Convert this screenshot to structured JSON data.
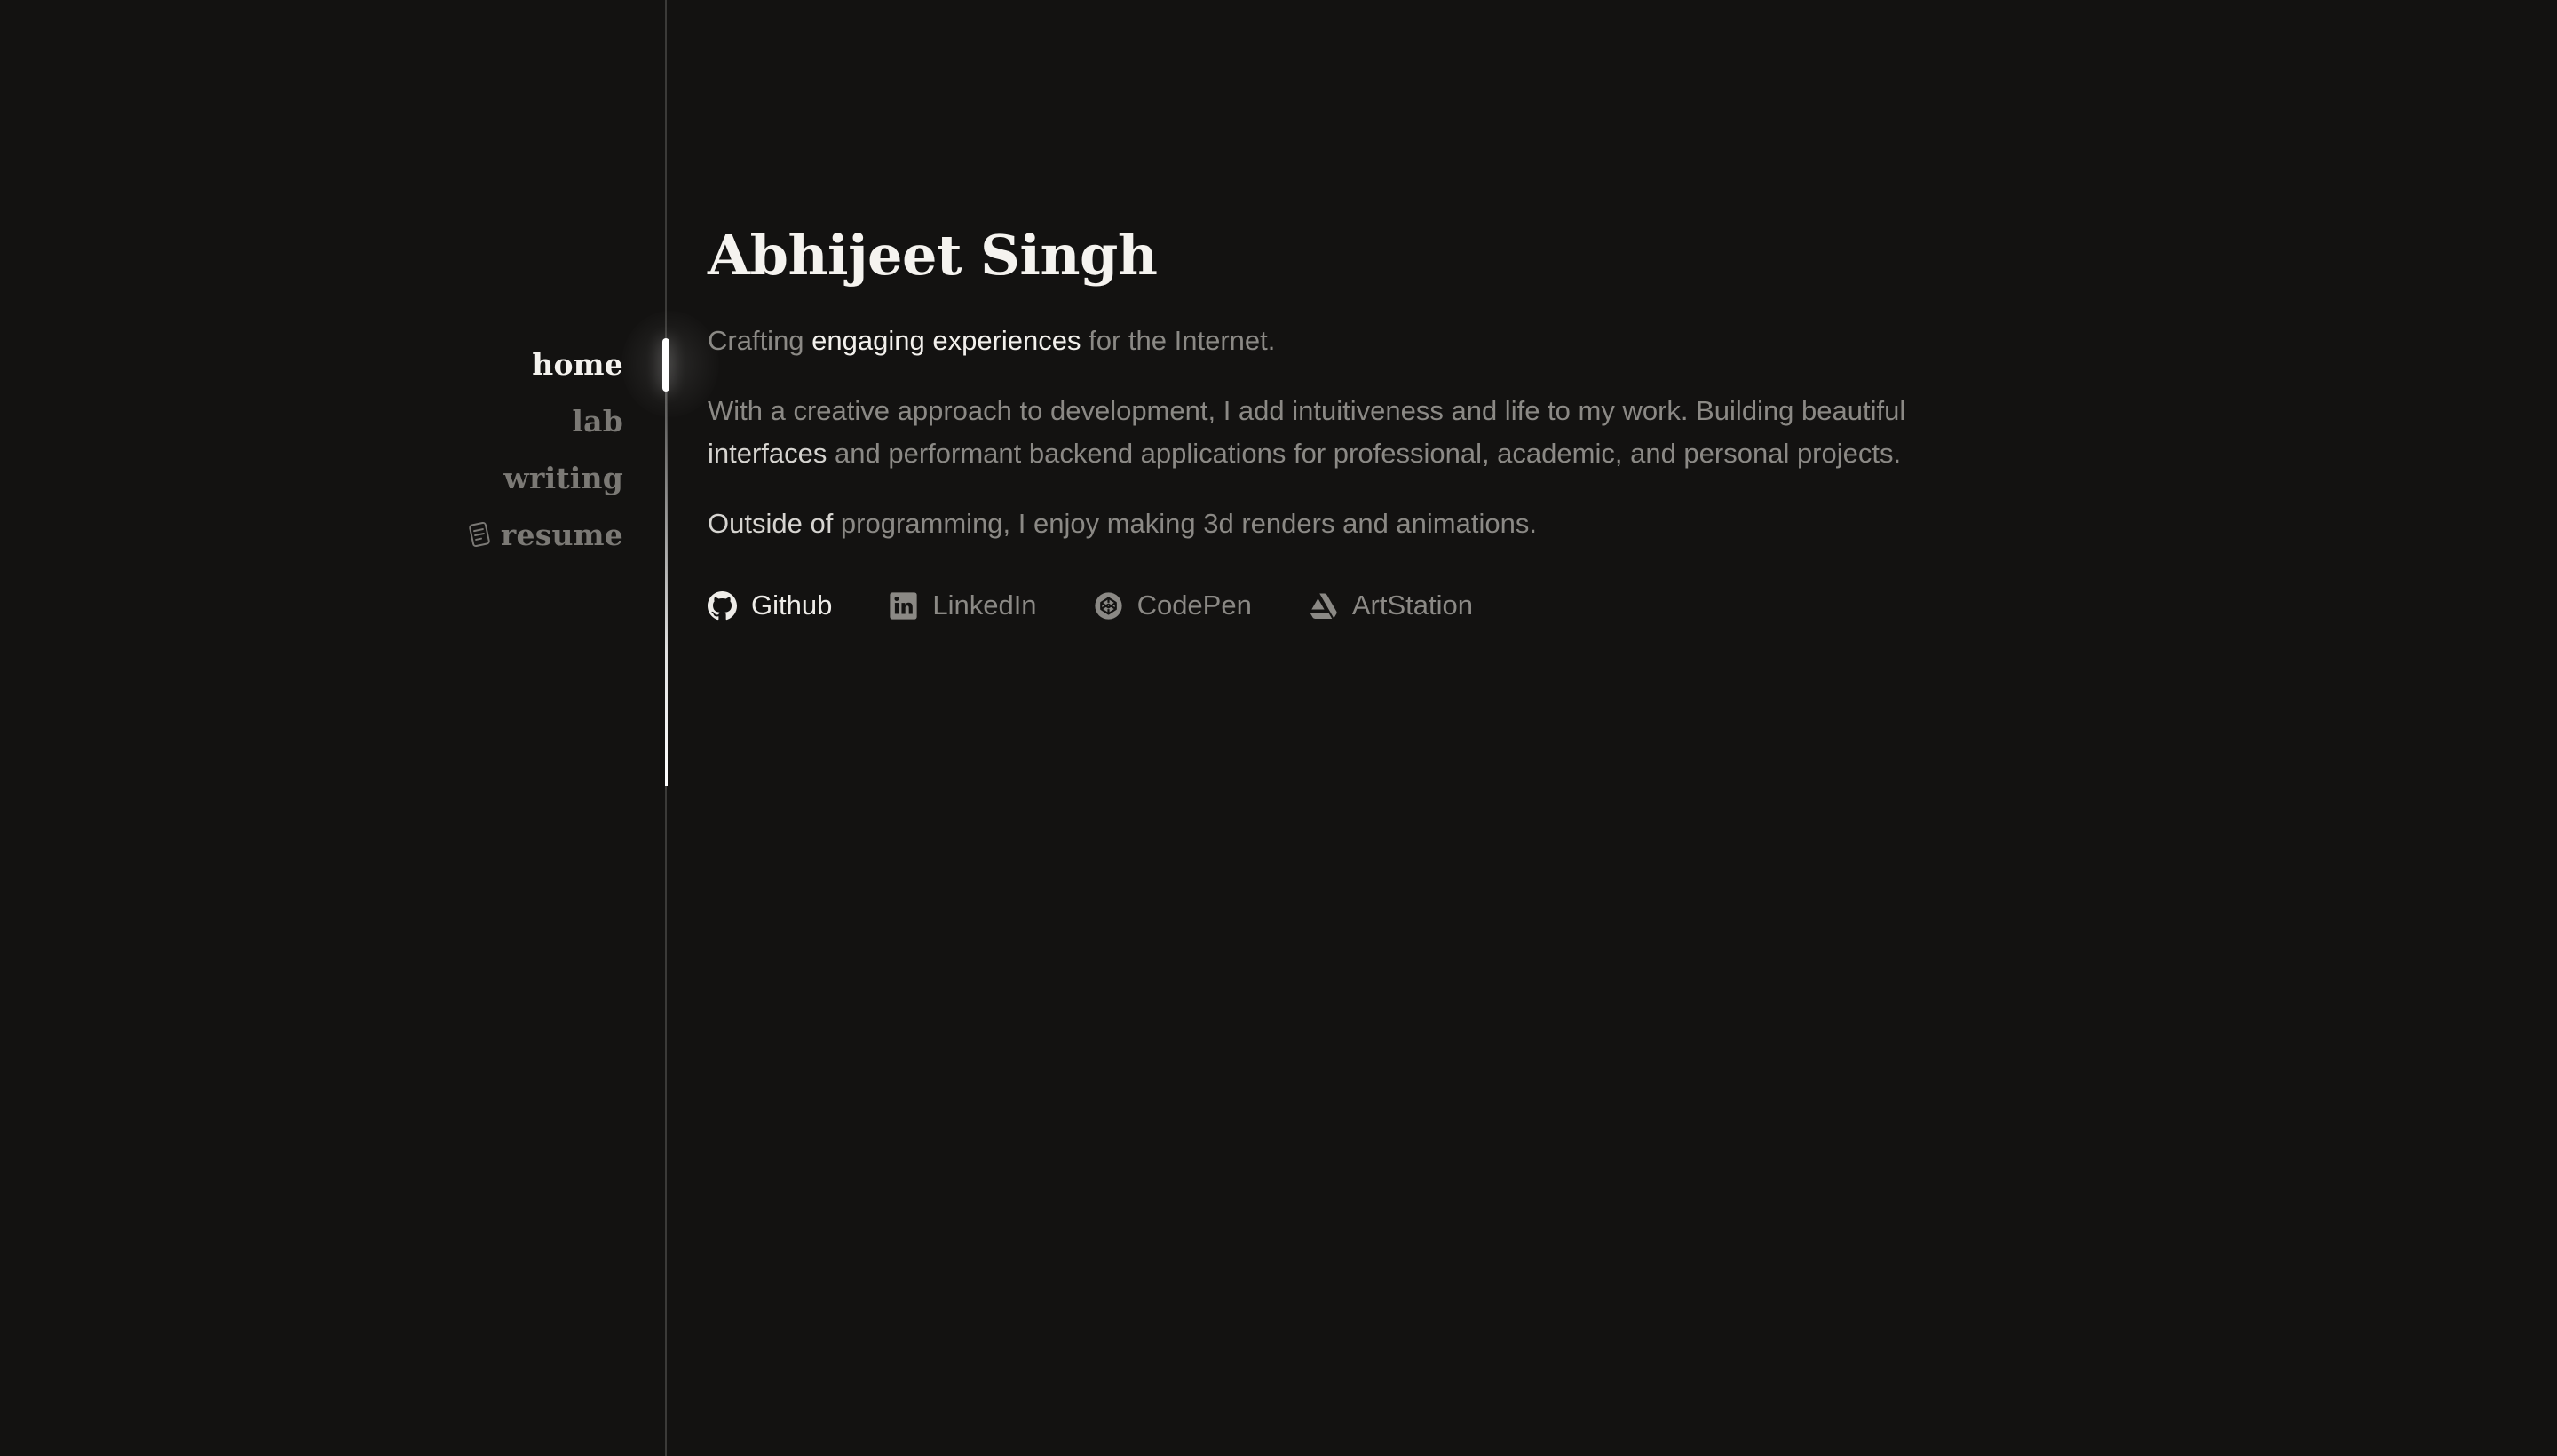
{
  "nav": {
    "items": [
      {
        "label": "home",
        "active": true
      },
      {
        "label": "lab",
        "active": false
      },
      {
        "label": "writing",
        "active": false
      },
      {
        "label": "resume",
        "active": false,
        "icon": "document-icon"
      }
    ]
  },
  "hero": {
    "name": "Abhijeet Singh",
    "tagline": {
      "pre": "Crafting ",
      "emphasis": "engaging experiences",
      "post": " for the Internet."
    },
    "bio": {
      "pre": "With a creative approach to development, I add intuitiveness and life to my work. Building beautiful ",
      "emphasis": "interfaces",
      "post": " and performant backend applications for professional, academic, and personal projects."
    },
    "outside": {
      "emphasis": "Outside of",
      "post": " programming, I enjoy making 3d renders and animations."
    }
  },
  "links": [
    {
      "label": "Github",
      "icon": "github-icon"
    },
    {
      "label": "LinkedIn",
      "icon": "linkedin-icon"
    },
    {
      "label": "CodePen",
      "icon": "codepen-icon"
    },
    {
      "label": "ArtStation",
      "icon": "artstation-icon"
    }
  ],
  "colors": {
    "background": "#131211",
    "text_primary": "#f5f3ef",
    "text_muted": "#8b8985",
    "rail": "#3b3a38",
    "rail_active": "#ffffff"
  }
}
